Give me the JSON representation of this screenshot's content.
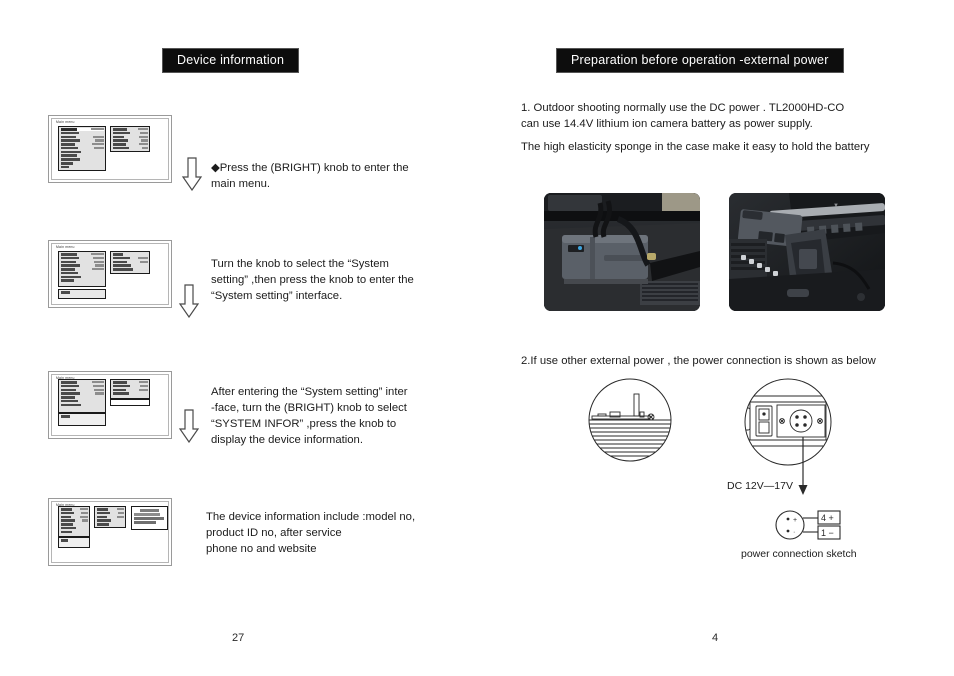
{
  "document": {
    "left_page": {
      "banner": "Device information",
      "page_number": "27",
      "steps": [
        {
          "id": "step-1",
          "text": "◆Press the (BRIGHT) knob to enter the\nmain menu."
        },
        {
          "id": "step-2",
          "text": "    Turn the knob  to select the “System\nsetting” ,then press the knob to enter the\n “System setting” interface."
        },
        {
          "id": "step-3",
          "text": "    After entering the “System setting” inter\n-face, turn the (BRIGHT) knob to select\n  “SYSTEM INFOR” ,press the knob to\ndisplay the device information."
        },
        {
          "id": "step-4",
          "text": "     The  device information include :model no,\nproduct ID no, after service\nphone no and website"
        }
      ],
      "lcd_panels": [
        {
          "name": "lcd-main-menu",
          "title": "Main menu"
        },
        {
          "name": "lcd-system-setting",
          "title": "Main menu"
        },
        {
          "name": "lcd-system-infor-select",
          "title": "Main menu"
        },
        {
          "name": "lcd-device-information",
          "title": "Main menu"
        }
      ],
      "arrows": [
        {
          "name": "flow-arrow-1"
        },
        {
          "name": "flow-arrow-2"
        },
        {
          "name": "flow-arrow-3"
        }
      ]
    },
    "right_page": {
      "banner": "Preparation before operation -external power",
      "page_number": "4",
      "paragraph_1": "1.  Outdoor shooting normally use the DC power . TL2000HD-CO\ncan use 14.4V lithium ion  camera  battery as  power supply.",
      "paragraph_2": "The high elasticity sponge in the case  make it easy to hold the battery",
      "paragraph_3": "2.If use other external power , the power connection is shown as below",
      "photos": [
        {
          "name": "photo-battery-in-case",
          "alt": "battery mounted in flight case"
        },
        {
          "name": "photo-camera-battery-plate",
          "alt": "camera battery plate in case"
        }
      ],
      "dc_label": "DC 12V—17V",
      "sketch_caption": "power connection sketch",
      "plug_pins": [
        {
          "label": "4 +"
        },
        {
          "label": "1 −"
        }
      ]
    }
  },
  "colors": {
    "banner_bg": "#0d0d0d",
    "banner_text": "#ffffff",
    "body_text": "#1c1c1c",
    "lcd_border": "#9a9a9a",
    "menu_box_bg": "#e2e2e2"
  }
}
